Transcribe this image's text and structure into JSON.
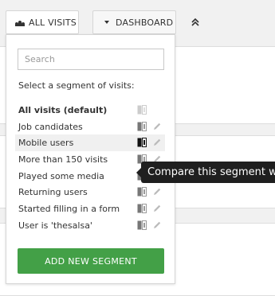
{
  "toolbar": {
    "visits_label": "ALL VISITS",
    "dashboard_label": "DASHBOARD"
  },
  "dropdown": {
    "search_placeholder": "Search",
    "instructions": "Select a segment of visits:",
    "segments": [
      {
        "label": "All visits (default)",
        "bold": true,
        "editable": false
      },
      {
        "label": "Job candidates",
        "editable": true
      },
      {
        "label": "Mobile users",
        "editable": true,
        "hovered": true
      },
      {
        "label": "More than 150 visits",
        "editable": true
      },
      {
        "label": "Played some media",
        "editable": true
      },
      {
        "label": "Returning users",
        "editable": true
      },
      {
        "label": "Started filling in a form",
        "editable": true
      },
      {
        "label": "User is 'thesalsa'",
        "editable": true
      }
    ],
    "add_button": "ADD NEW SEGMENT"
  },
  "tooltip": "Compare this segment w",
  "colors": {
    "add_button": "#43a047",
    "tooltip_bg": "#1f1f1f"
  }
}
